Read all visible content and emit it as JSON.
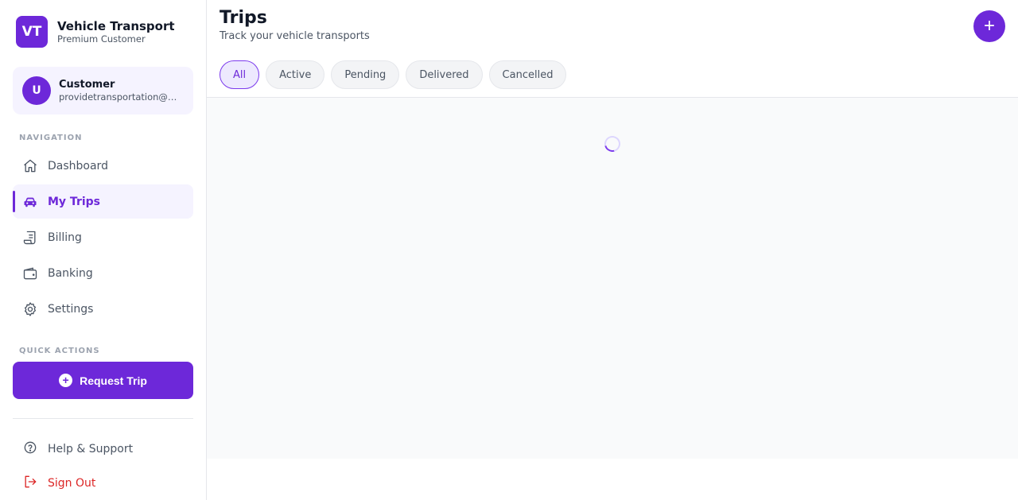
{
  "brand": {
    "logo": "VT",
    "title": "Vehicle Transport",
    "subtitle": "Premium Customer"
  },
  "user": {
    "initial": "U",
    "name": "Customer",
    "email": "providetransportation@g..."
  },
  "nav": {
    "section_label": "NAVIGATION",
    "items": [
      {
        "label": "Dashboard",
        "icon": "home-icon"
      },
      {
        "label": "My Trips",
        "icon": "car-icon",
        "active": true
      },
      {
        "label": "Billing",
        "icon": "receipt-icon"
      },
      {
        "label": "Banking",
        "icon": "wallet-icon"
      },
      {
        "label": "Settings",
        "icon": "gear-icon"
      }
    ]
  },
  "quick_actions": {
    "section_label": "QUICK ACTIONS",
    "request_label": "Request Trip"
  },
  "bottom": {
    "help_label": "Help & Support",
    "signout_label": "Sign Out"
  },
  "page": {
    "title": "Trips",
    "subtitle": "Track your vehicle transports",
    "add_button": "+"
  },
  "filters": [
    "All",
    "Active",
    "Pending",
    "Delivered",
    "Cancelled"
  ],
  "colors": {
    "accent": "#6d28d9",
    "accent_light": "#f5f3ff",
    "danger": "#dc2626"
  }
}
